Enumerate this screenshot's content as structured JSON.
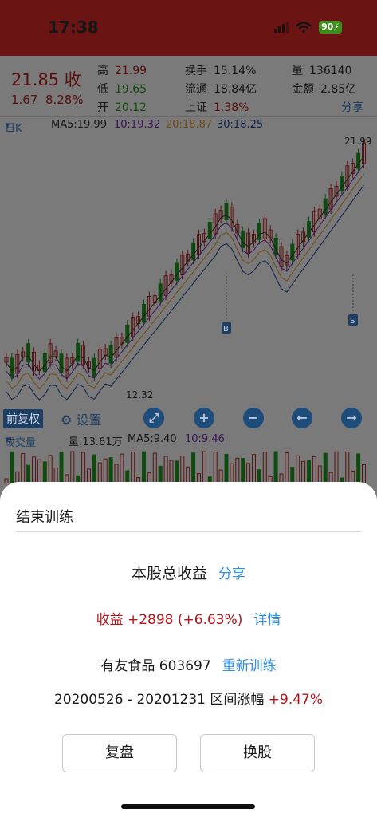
{
  "status": {
    "time": "17:38",
    "battery": "90"
  },
  "quote": {
    "price": "21.85 收",
    "change": "1.67",
    "change_pct": "8.28%",
    "high_label": "高",
    "high": "21.99",
    "low_label": "低",
    "low": "19.65",
    "open_label": "开",
    "open": "20.12",
    "turnover_label": "换手",
    "turnover": "15.14%",
    "float_label": "流通",
    "float": "18.84亿",
    "index_label": "上证",
    "index": "1.38%",
    "volume_label": "量",
    "volume": "136140",
    "amount_label": "金额",
    "amount": "2.85亿",
    "share": "分享"
  },
  "ma_row": {
    "period": "日K",
    "ma5": "MA5:19.99",
    "ma10": "10:19.32",
    "ma20": "20:18.87",
    "ma30": "30:18.25"
  },
  "chart": {
    "high_marker": "21.99",
    "low_marker": "12.32",
    "buy_marker": "B",
    "sell_marker": "S"
  },
  "toolbar": {
    "fuquan": "前复权",
    "settings": "设置",
    "expand_icon": "expand-icon",
    "zoom_in_icon": "plus-icon",
    "zoom_out_icon": "minus-icon",
    "prev_icon": "arrow-left-icon",
    "next_icon": "arrow-right-icon"
  },
  "volume_row": {
    "label": "成交量",
    "vol": "量:13.61万",
    "ma5": "MA5:9.40",
    "ma10": "10:9.46"
  },
  "sheet": {
    "title": "结束训练",
    "total_label": "本股总收益",
    "share": "分享",
    "profit": "收益 +2898 (+6.63%)",
    "details": "详情",
    "stock": "有友食品 603697",
    "retrain": "重新训练",
    "range": "20200526 - 20201231 区间涨幅 ",
    "range_pct": "+9.47%",
    "review_button": "复盘",
    "switch_button": "换股"
  },
  "colors": {
    "up": "#5c1212",
    "down": "#114a10",
    "accent": "#2f8ee5",
    "profit": "#b3151a"
  }
}
